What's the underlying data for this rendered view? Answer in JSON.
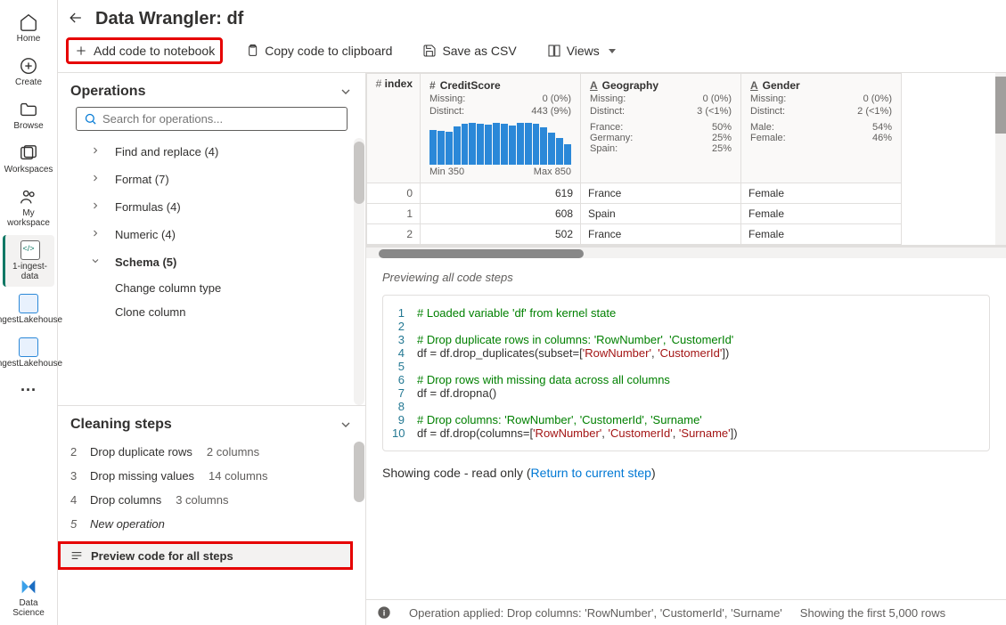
{
  "leftbar": [
    {
      "label": "Home",
      "icon": "home-icon"
    },
    {
      "label": "Create",
      "icon": "plus-circle-icon"
    },
    {
      "label": "Browse",
      "icon": "folder-icon"
    },
    {
      "label": "Workspaces",
      "icon": "workspaces-icon"
    },
    {
      "label": "My workspace",
      "icon": "people-icon"
    },
    {
      "label": "1-ingest-data",
      "icon": "notebook-file-icon",
      "active": true
    },
    {
      "label": "IngestLakehouse",
      "icon": "lakehouse-icon"
    },
    {
      "label": "IngestLakehouse",
      "icon": "lakehouse-icon"
    }
  ],
  "header": {
    "title": "Data Wrangler: df"
  },
  "toolbar": {
    "add_code": "Add code to notebook",
    "copy_code": "Copy code to clipboard",
    "save_csv": "Save as CSV",
    "views": "Views"
  },
  "operations": {
    "title": "Operations",
    "search_placeholder": "Search for operations...",
    "items": [
      {
        "label": "Find and replace (4)",
        "expanded": false
      },
      {
        "label": "Format (7)",
        "expanded": false
      },
      {
        "label": "Formulas (4)",
        "expanded": false
      },
      {
        "label": "Numeric (4)",
        "expanded": false
      },
      {
        "label": "Schema (5)",
        "expanded": true,
        "children": [
          "Change column type",
          "Clone column"
        ]
      }
    ]
  },
  "steps": {
    "title": "Cleaning steps",
    "items": [
      {
        "num": "2",
        "label": "Drop duplicate rows",
        "meta": "2 columns"
      },
      {
        "num": "3",
        "label": "Drop missing values",
        "meta": "14 columns"
      },
      {
        "num": "4",
        "label": "Drop columns",
        "meta": "3 columns"
      },
      {
        "num": "5",
        "label": "New operation",
        "italic": true
      }
    ],
    "preview_all": "Preview code for all steps"
  },
  "table": {
    "columns": [
      {
        "name": "index",
        "icon": "#",
        "width": 70,
        "showIndexOnly": true
      },
      {
        "name": "CreditScore",
        "icon": "#",
        "missing_label": "Missing:",
        "missing_val": "0 (0%)",
        "distinct_label": "Distinct:",
        "distinct_val": "443 (9%)",
        "histogram": [
          82,
          80,
          78,
          90,
          95,
          97,
          96,
          94,
          97,
          96,
          92,
          98,
          97,
          95,
          88,
          74,
          62,
          48
        ],
        "min": "Min 350",
        "max": "Max 850"
      },
      {
        "name": "Geography",
        "icon": "A",
        "missing_label": "Missing:",
        "missing_val": "0 (0%)",
        "distinct_label": "Distinct:",
        "distinct_val": "3 (<1%)",
        "distrib": [
          {
            "k": "France:",
            "v": "50%"
          },
          {
            "k": "Germany:",
            "v": "25%"
          },
          {
            "k": "Spain:",
            "v": "25%"
          }
        ]
      },
      {
        "name": "Gender",
        "icon": "A",
        "missing_label": "Missing:",
        "missing_val": "0 (0%)",
        "distinct_label": "Distinct:",
        "distinct_val": "2 (<1%)",
        "distrib": [
          {
            "k": "Male:",
            "v": "54%"
          },
          {
            "k": "Female:",
            "v": "46%"
          }
        ]
      }
    ],
    "rows": [
      {
        "index": "0",
        "CreditScore": "619",
        "Geography": "France",
        "Gender": "Female"
      },
      {
        "index": "1",
        "CreditScore": "608",
        "Geography": "Spain",
        "Gender": "Female"
      },
      {
        "index": "2",
        "CreditScore": "502",
        "Geography": "France",
        "Gender": "Female"
      }
    ]
  },
  "code": {
    "title": "Previewing all code steps",
    "lines": [
      {
        "n": "1",
        "segments": [
          {
            "t": "# Loaded variable 'df' from kernel state",
            "c": "c-comment"
          }
        ]
      },
      {
        "n": "2",
        "segments": []
      },
      {
        "n": "3",
        "segments": [
          {
            "t": "# Drop duplicate rows in columns: 'RowNumber', 'CustomerId'",
            "c": "c-comment"
          }
        ]
      },
      {
        "n": "4",
        "segments": [
          {
            "t": "df = df.drop_duplicates(subset=["
          },
          {
            "t": "'RowNumber'",
            "c": "c-str"
          },
          {
            "t": ", "
          },
          {
            "t": "'CustomerId'",
            "c": "c-str"
          },
          {
            "t": "])"
          }
        ]
      },
      {
        "n": "5",
        "segments": []
      },
      {
        "n": "6",
        "segments": [
          {
            "t": "# Drop rows with missing data across all columns",
            "c": "c-comment"
          }
        ]
      },
      {
        "n": "7",
        "segments": [
          {
            "t": "df = df.dropna()"
          }
        ]
      },
      {
        "n": "8",
        "segments": []
      },
      {
        "n": "9",
        "segments": [
          {
            "t": "# Drop columns: 'RowNumber', 'CustomerId', 'Surname'",
            "c": "c-comment"
          }
        ]
      },
      {
        "n": "10",
        "segments": [
          {
            "t": "df = df.drop(columns=["
          },
          {
            "t": "'RowNumber'",
            "c": "c-str"
          },
          {
            "t": ", "
          },
          {
            "t": "'CustomerId'",
            "c": "c-str"
          },
          {
            "t": ", "
          },
          {
            "t": "'Surname'",
            "c": "c-str"
          },
          {
            "t": "])"
          }
        ]
      }
    ],
    "status_prefix": "Showing code - read only (",
    "status_link": "Return to current step",
    "status_suffix": ")"
  },
  "statusbar": {
    "msg": "Operation applied: Drop columns: 'RowNumber', 'CustomerId', 'Surname'",
    "rows": "Showing the first 5,000 rows"
  },
  "datascience": {
    "label": "Data Science"
  }
}
